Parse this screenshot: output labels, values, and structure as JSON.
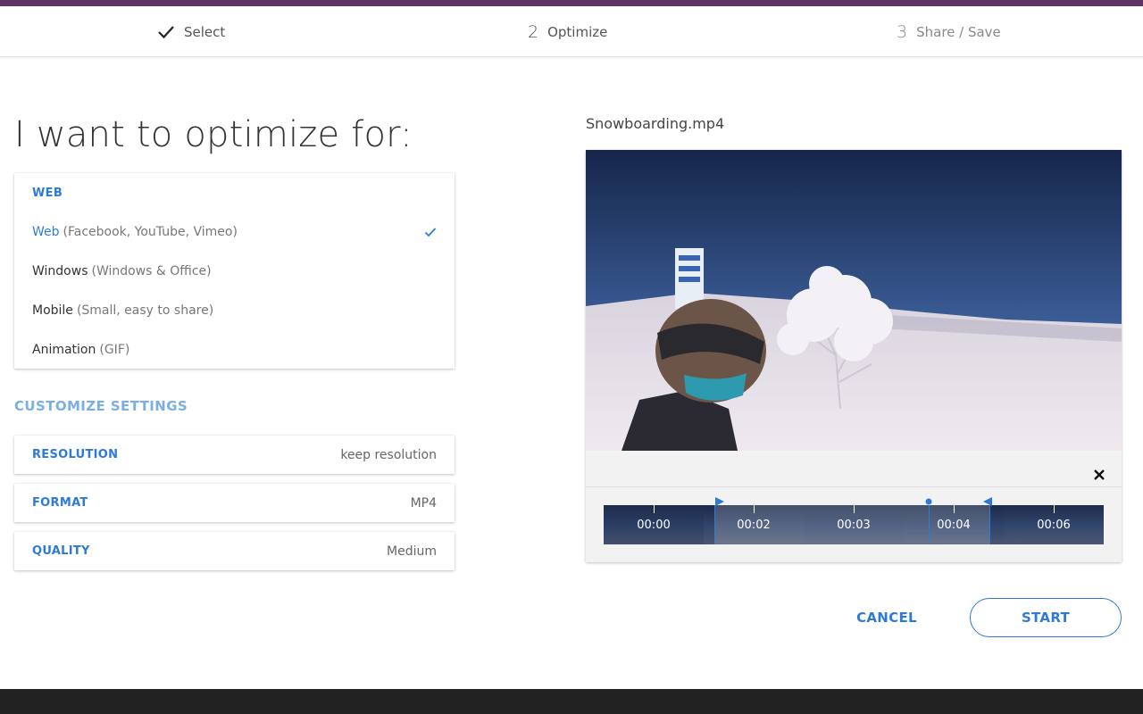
{
  "steps": [
    {
      "num": "",
      "label": "Select",
      "state": "done"
    },
    {
      "num": "2",
      "label": "Optimize",
      "state": "active"
    },
    {
      "num": "3",
      "label": "Share / Save",
      "state": "future"
    }
  ],
  "headline": "I want to optimize for:",
  "presets": {
    "header": "WEB",
    "items": [
      {
        "name": "Web",
        "detail": "(Facebook, YouTube, Vimeo)",
        "selected": true
      },
      {
        "name": "Windows",
        "detail": "(Windows & Office)",
        "selected": false
      },
      {
        "name": "Mobile",
        "detail": "(Small, easy to share)",
        "selected": false
      },
      {
        "name": "Animation",
        "detail": "(GIF)",
        "selected": false
      }
    ]
  },
  "customize": {
    "title": "CUSTOMIZE SETTINGS",
    "resolution": {
      "label": "RESOLUTION",
      "value": "keep resolution"
    },
    "format": {
      "label": "FORMAT",
      "value": "MP4"
    },
    "quality": {
      "label": "QUALITY",
      "value": "Medium"
    }
  },
  "video": {
    "filename": "Snowboarding.mp4",
    "timeline_labels": [
      "00:00",
      "00:02",
      "00:03",
      "00:04",
      "00:06"
    ]
  },
  "actions": {
    "cancel": "CANCEL",
    "start": "START"
  },
  "colors": {
    "accent": "#2d7bd6",
    "brand": "#5c3566",
    "footer": "#222222"
  }
}
